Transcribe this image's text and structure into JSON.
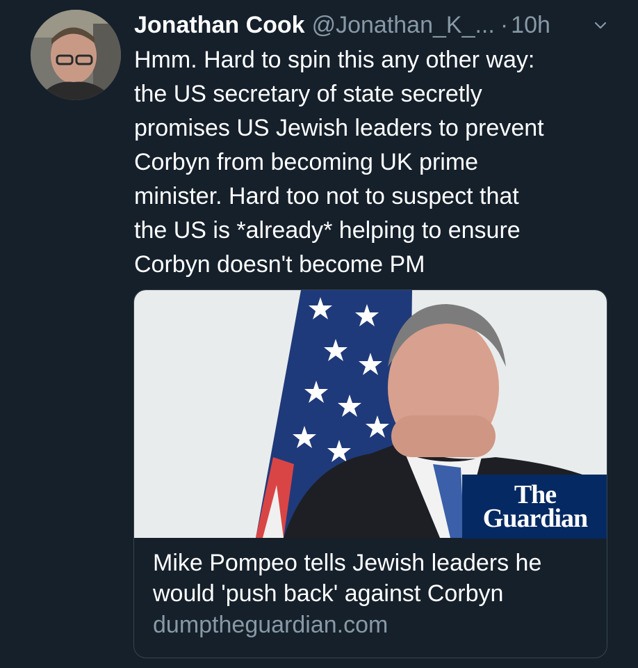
{
  "tweet": {
    "author_name": "Jonathan Cook",
    "handle": "@Jonathan_K_...",
    "separator": "·",
    "time": "10h",
    "text": "Hmm. Hard to spin this any other way:\nthe US secretary of state secretly\npromises US Jewish leaders to prevent\nCorbyn from becoming UK prime\nminister. Hard too not to suspect that\nthe US is *already* helping to ensure\nCorbyn doesn't become PM"
  },
  "card": {
    "title": "Mike Pompeo tells Jewish leaders he would 'push back' against Corbyn",
    "domain": "dumptheguardian.com",
    "logo_line1": "The",
    "logo_line2": "Guardian"
  },
  "icons": {
    "menu": "chevron-down-icon"
  },
  "colors": {
    "background": "#15202b",
    "secondary_text": "#8899a6",
    "card_border": "#38444d",
    "guardian_blue": "#052962"
  }
}
